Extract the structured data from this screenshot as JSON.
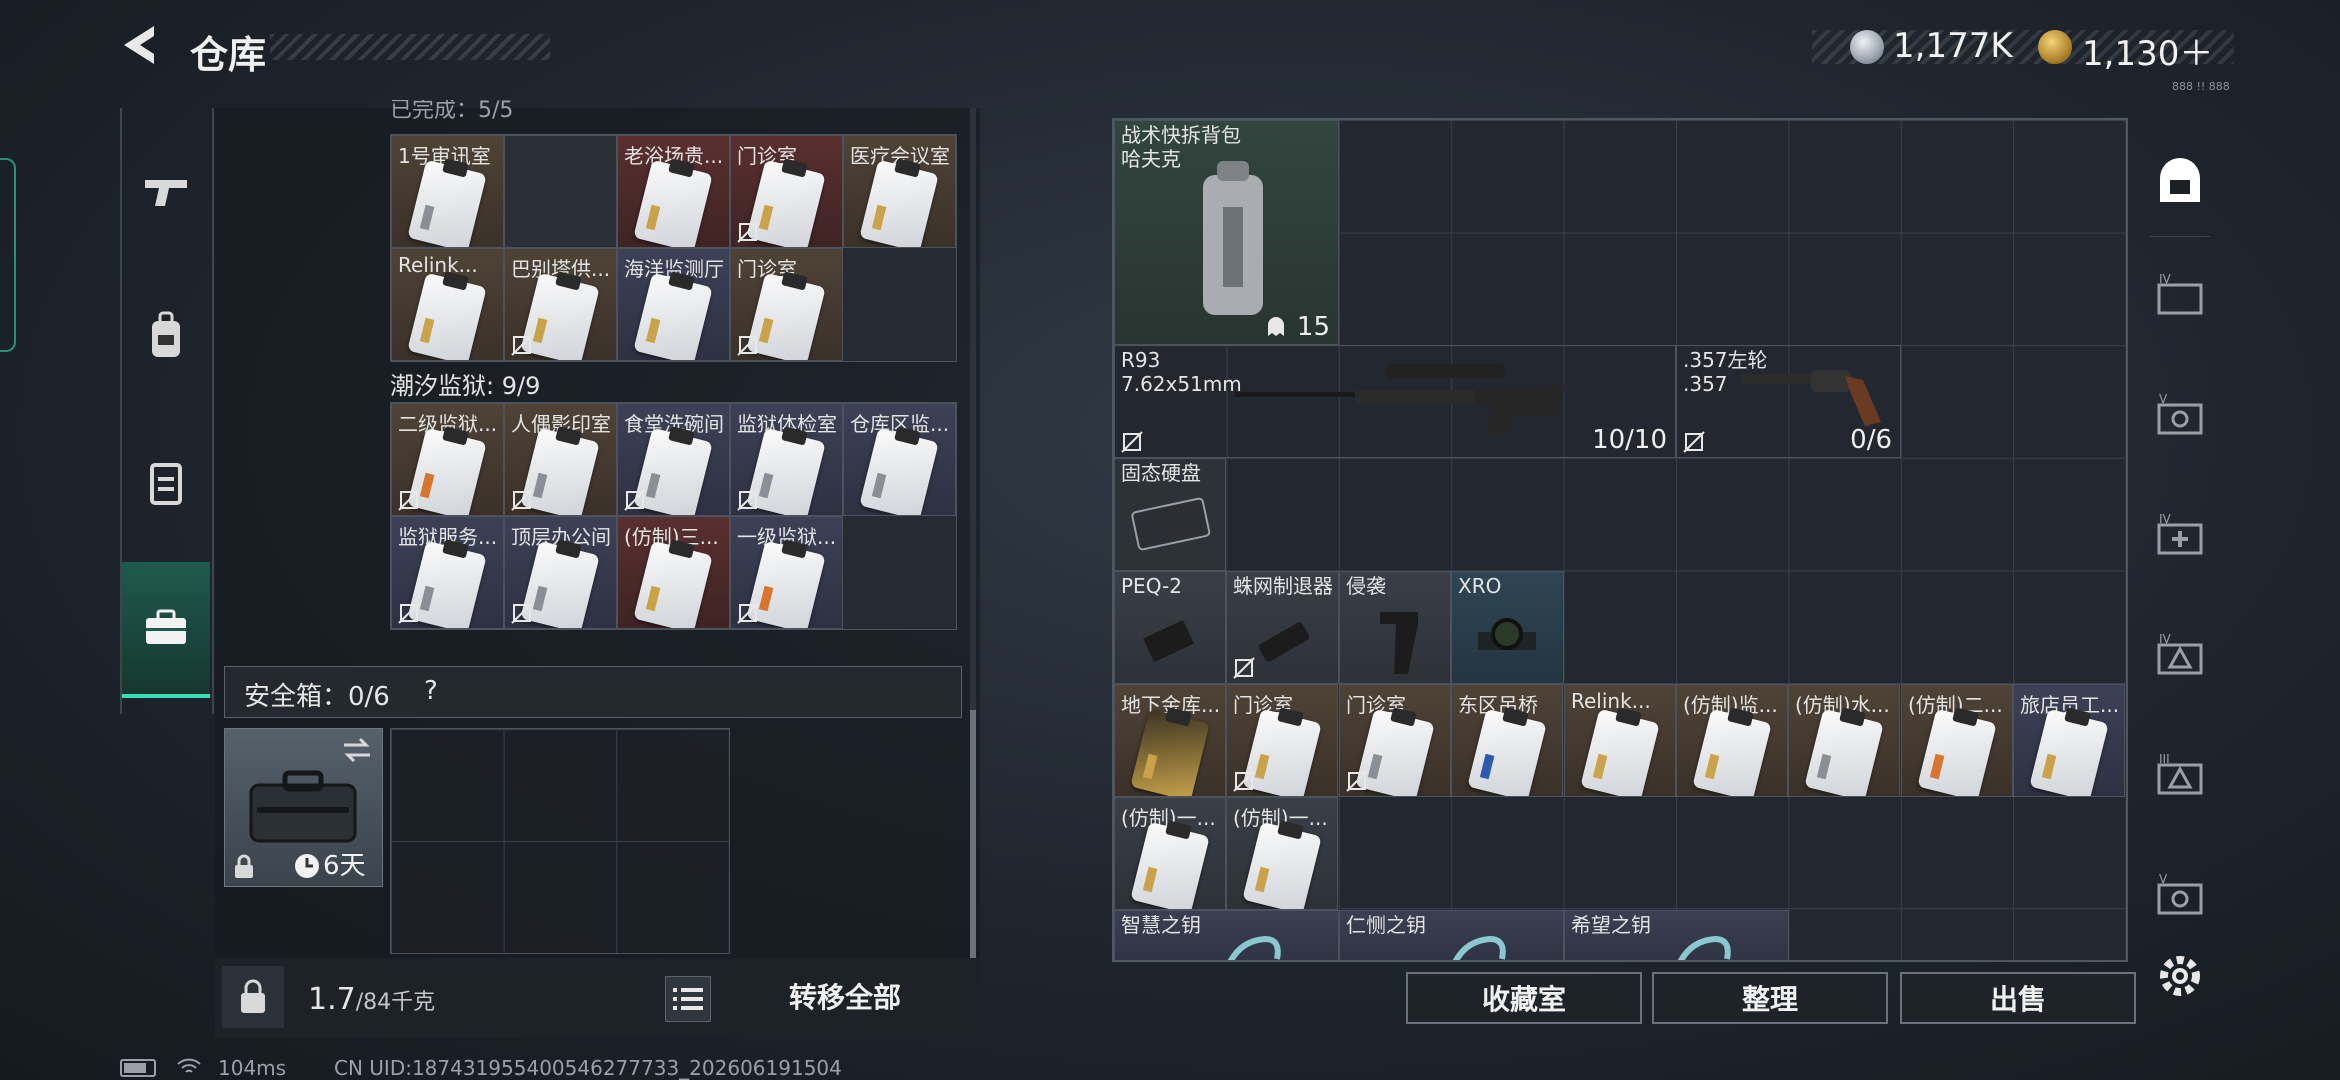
{
  "header": {
    "title": "仓库",
    "currency1": "1,177K",
    "currency2": "1,130＋",
    "tiny_label": "888 !! 888"
  },
  "left": {
    "top_cut_label": "已完成：5/5",
    "rows1": [
      [
        {
          "name": "1号审讯室",
          "color": "brown",
          "stripe": "#8a8f96",
          "nobind": false
        },
        {
          "name": "",
          "color": "empty"
        },
        {
          "name": "老浴场贵...",
          "color": "red",
          "stripe": "#c9a24a",
          "nobind": false
        },
        {
          "name": "门诊室",
          "color": "red",
          "stripe": "#c9a24a",
          "nobind": true
        },
        {
          "name": "医疗会议室",
          "color": "brown",
          "stripe": "#c9a24a",
          "nobind": false
        }
      ],
      [
        {
          "name": "Relink...",
          "color": "brown",
          "stripe": "#c9a24a",
          "nobind": false
        },
        {
          "name": "巴别塔供...",
          "color": "brown",
          "stripe": "#c9a24a",
          "nobind": true
        },
        {
          "name": "海洋监测厅",
          "color": "navy",
          "stripe": "#c9a24a",
          "nobind": false
        },
        {
          "name": "门诊室",
          "color": "brown",
          "stripe": "#c9a24a",
          "nobind": true
        }
      ]
    ],
    "section_label": "潮汐监狱: 9/9",
    "rows2": [
      [
        {
          "name": "二级监狱...",
          "color": "brown",
          "stripe": "#d7742e",
          "nobind": true
        },
        {
          "name": "人偶影印室",
          "color": "brown",
          "stripe": "#8a8f96",
          "nobind": true
        },
        {
          "name": "食堂洗碗间",
          "color": "navy",
          "stripe": "#8a8f96",
          "nobind": true
        },
        {
          "name": "监狱体检室",
          "color": "navy",
          "stripe": "#8a8f96",
          "nobind": true
        },
        {
          "name": "仓库区监...",
          "color": "navy",
          "stripe": "#8a8f96",
          "nobind": false
        }
      ],
      [
        {
          "name": "监狱服务...",
          "color": "navy",
          "stripe": "#8a8f96",
          "nobind": true
        },
        {
          "name": "顶层办公间",
          "color": "navy",
          "stripe": "#8a8f96",
          "nobind": true
        },
        {
          "name": "(仿制)三...",
          "color": "red",
          "stripe": "#c9a24a",
          "nobind": false
        },
        {
          "name": "一级监狱...",
          "color": "navy",
          "stripe": "#d7742e",
          "nobind": true
        }
      ]
    ],
    "safe_label": "安全箱：0/6",
    "safe_help": "?",
    "safe_timer": "6天",
    "weight": "1.7",
    "weight_unit": "/84千克",
    "transfer_label": "转移全部"
  },
  "right": {
    "backpack": {
      "name_line1": "战术快拆背包",
      "name_line2": "哈夫克",
      "count": "15"
    },
    "r93": {
      "name_line1": "R93",
      "name_line2": "7.62x51mm",
      "ammo": "10/10"
    },
    "revolver": {
      "name_line1": ".357左轮",
      "name_line2": ".357",
      "ammo": "0/6"
    },
    "ssd": {
      "name": "固态硬盘"
    },
    "row4": [
      {
        "name": "PEQ-2"
      },
      {
        "name": "蛛网制退器"
      },
      {
        "name": "侵袭"
      },
      {
        "name": "XRO"
      }
    ],
    "row5": [
      {
        "name": "地下金库...",
        "color": "brown",
        "stripe": "#c9a24a",
        "gold": true,
        "nobind": false
      },
      {
        "name": "门诊室",
        "color": "brown",
        "stripe": "#c9a24a",
        "nobind": true
      },
      {
        "name": "门诊室",
        "color": "brown",
        "stripe": "#8a8f96",
        "nobind": true
      },
      {
        "name": "东区吊桥",
        "color": "brown",
        "stripe": "#2e59b0",
        "nobind": false
      },
      {
        "name": "Relink...",
        "color": "brown",
        "stripe": "#c9a24a",
        "nobind": false
      },
      {
        "name": "(仿制)监...",
        "color": "brown",
        "stripe": "#c9a24a",
        "nobind": false
      },
      {
        "name": "(仿制)水...",
        "color": "brown",
        "stripe": "#8a8f96",
        "nobind": false
      },
      {
        "name": "(仿制)二...",
        "color": "brown",
        "stripe": "#d7742e",
        "nobind": false
      },
      {
        "name": "旅店员工...",
        "color": "navy",
        "stripe": "#c9a24a",
        "nobind": false
      }
    ],
    "row6": [
      {
        "name": "(仿制)一...",
        "stripe": "#c9a24a"
      },
      {
        "name": "(仿制)一...",
        "stripe": "#c9a24a"
      }
    ],
    "row7": [
      {
        "name": "智慧之钥"
      },
      {
        "name": "仁恻之钥"
      },
      {
        "name": "希望之钥"
      }
    ],
    "actions": {
      "collection": "收藏室",
      "sort": "整理",
      "sell": "出售"
    }
  },
  "status": {
    "ping": "104ms",
    "uid": "CN UID:187431955400546277733_202606191504"
  }
}
